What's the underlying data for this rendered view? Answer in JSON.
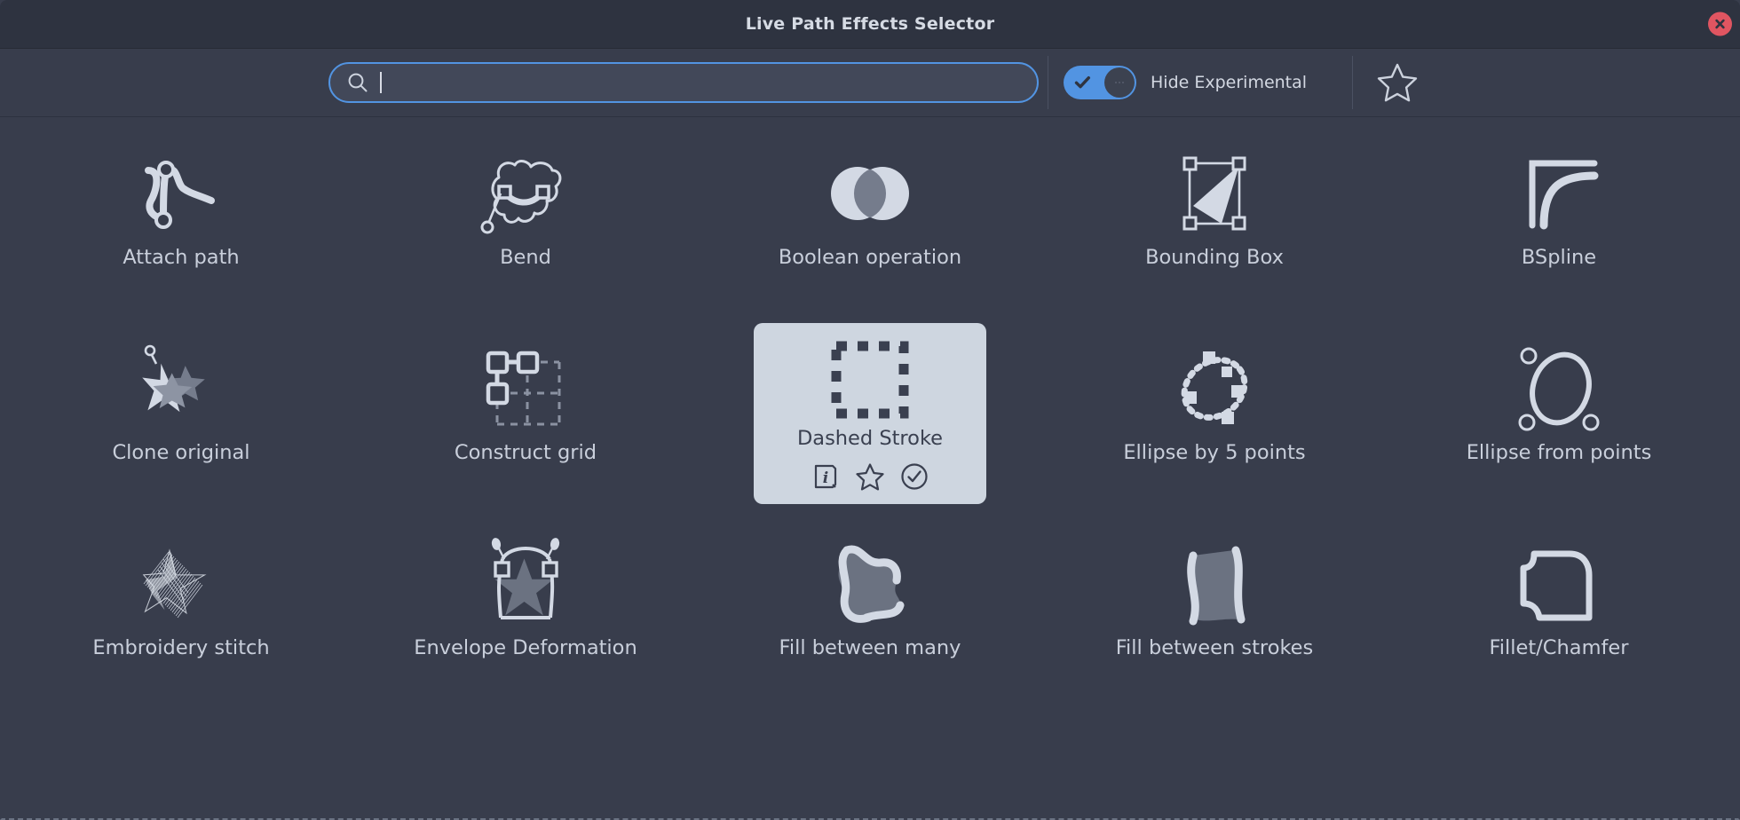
{
  "window": {
    "title": "Live Path Effects Selector",
    "close_label": "Close",
    "close_icon": "close-icon"
  },
  "toolbar": {
    "search": {
      "value": "",
      "placeholder": "",
      "icon": "search-icon"
    },
    "hide_experimental": {
      "label": "Hide Experimental",
      "checked": true,
      "state_text": "on"
    },
    "favorites_filter": {
      "icon": "star-outline-icon",
      "label": "Show favorites only"
    }
  },
  "grid": {
    "selected_index": 7,
    "items": [
      {
        "label": "Attach path",
        "icon": "attach-path-icon"
      },
      {
        "label": "Bend",
        "icon": "bend-icon"
      },
      {
        "label": "Boolean operation",
        "icon": "boolean-operation-icon"
      },
      {
        "label": "Bounding Box",
        "icon": "bounding-box-icon"
      },
      {
        "label": "BSpline",
        "icon": "bspline-icon"
      },
      {
        "label": "Clone original",
        "icon": "clone-original-icon"
      },
      {
        "label": "Construct grid",
        "icon": "construct-grid-icon"
      },
      {
        "label": "Dashed Stroke",
        "icon": "dashed-stroke-icon"
      },
      {
        "label": "Ellipse by 5 points",
        "icon": "ellipse-by-5-points-icon"
      },
      {
        "label": "Ellipse from points",
        "icon": "ellipse-from-points-icon"
      },
      {
        "label": "Embroidery stitch",
        "icon": "embroidery-stitch-icon"
      },
      {
        "label": "Envelope Deformation",
        "icon": "envelope-deformation-icon"
      },
      {
        "label": "Fill between many",
        "icon": "fill-between-many-icon"
      },
      {
        "label": "Fill between strokes",
        "icon": "fill-between-strokes-icon"
      },
      {
        "label": "Fillet/Chamfer",
        "icon": "fillet-chamfer-icon"
      }
    ]
  },
  "selected_tile_actions": [
    {
      "name": "info-icon",
      "label": "Info"
    },
    {
      "name": "star-icon",
      "label": "Favorite"
    },
    {
      "name": "check-icon",
      "label": "Apply"
    }
  ],
  "colors": {
    "window_bg": "#383d4c",
    "titlebar_bg": "#2e3340",
    "accent": "#5294e2",
    "selected_tile_bg": "#ced6e0",
    "close_button": "#e05561",
    "icon_light": "#d3d9e4",
    "text": "#c9cfdb"
  }
}
